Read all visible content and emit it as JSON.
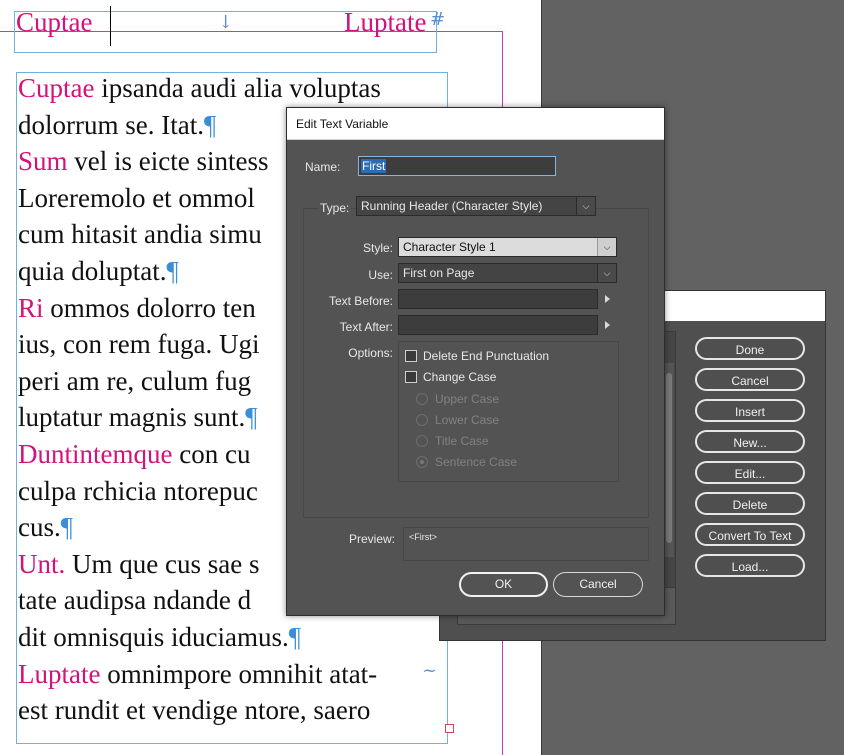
{
  "document": {
    "header": {
      "left": "Cuptae",
      "right": "Luptate",
      "right_mark": "#",
      "center_mark": "↓"
    },
    "lines": [
      [
        {
          "t": "Cuptae",
          "c": "pink"
        },
        {
          "t": " ipsanda audi alia voluptas",
          "c": ""
        }
      ],
      [
        {
          "t": "dolorrum se. Itat.",
          "c": ""
        },
        {
          "t": "¶",
          "c": "pil"
        }
      ],
      [
        {
          "t": "Sum",
          "c": "pink"
        },
        {
          "t": " vel is eicte sintess",
          "c": ""
        }
      ],
      [
        {
          "t": "Loreremolo et ommol",
          "c": ""
        }
      ],
      [
        {
          "t": "cum hitasit andia simu",
          "c": ""
        }
      ],
      [
        {
          "t": "quia doluptat.",
          "c": ""
        },
        {
          "t": "¶",
          "c": "pil"
        }
      ],
      [
        {
          "t": "Ri",
          "c": "pink"
        },
        {
          "t": " ommos dolorro ten",
          "c": ""
        }
      ],
      [
        {
          "t": "ius, con rem fuga. Ugi",
          "c": ""
        }
      ],
      [
        {
          "t": "peri am re, culum fug",
          "c": ""
        }
      ],
      [
        {
          "t": "luptatur magnis sunt.",
          "c": ""
        },
        {
          "t": "¶",
          "c": "pil"
        }
      ],
      [
        {
          "t": "Duntintemque",
          "c": "pink"
        },
        {
          "t": " con cu",
          "c": ""
        }
      ],
      [
        {
          "t": "culpa rchicia ntorepuc",
          "c": ""
        }
      ],
      [
        {
          "t": "cus.",
          "c": ""
        },
        {
          "t": "¶",
          "c": "pil"
        }
      ],
      [
        {
          "t": "Unt.",
          "c": "pink"
        },
        {
          "t": " Um que cus sae s",
          "c": ""
        }
      ],
      [
        {
          "t": "tate audipsa ndande d",
          "c": ""
        }
      ],
      [
        {
          "t": "dit omnisquis iduciamus.",
          "c": ""
        },
        {
          "t": "¶",
          "c": "pil"
        }
      ],
      [
        {
          "t": "Luptate",
          "c": "pink"
        },
        {
          "t": " omnimpore omnihit atat-",
          "c": ""
        }
      ],
      [
        {
          "t": "est rundit et vendige ntore, saero",
          "c": ""
        }
      ]
    ],
    "line_end_mark": "~"
  },
  "text_variables_dialog": {
    "buttons": [
      "Done",
      "Cancel",
      "Insert",
      "New...",
      "Edit...",
      "Delete",
      "Convert To Text",
      "Load..."
    ]
  },
  "edit_dialog": {
    "title": "Edit Text Variable",
    "name_label": "Name:",
    "name_value": "First",
    "type_label": "Type:",
    "type_value": "Running Header (Character Style)",
    "style_label": "Style:",
    "style_value": "Character Style 1",
    "use_label": "Use:",
    "use_value": "First on Page",
    "text_before_label": "Text Before:",
    "text_before_value": "",
    "text_after_label": "Text After:",
    "text_after_value": "",
    "options_label": "Options:",
    "delete_end_punct": "Delete End Punctuation",
    "change_case": "Change Case",
    "upper_case": "Upper Case",
    "lower_case": "Lower Case",
    "title_case": "Title Case",
    "sentence_case": "Sentence Case",
    "preview_label": "Preview:",
    "preview_value": "<First>",
    "ok": "OK",
    "cancel": "Cancel"
  },
  "colors": {
    "accent_pink": "#d3127a",
    "pilcrow_blue": "#3a8ed7",
    "frame_blue": "#6fb2df",
    "guide_magenta": "#c43bb0"
  }
}
